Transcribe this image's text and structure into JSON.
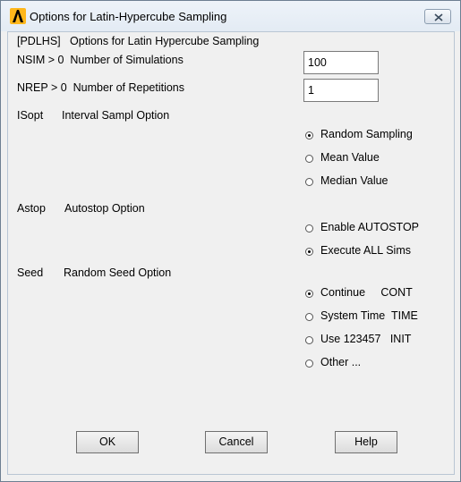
{
  "window": {
    "title": "Options for Latin-Hypercube Sampling",
    "close_label": "×"
  },
  "header": {
    "text": "[PDLHS]   Options for Latin Hypercube Sampling"
  },
  "fields": {
    "nsim": {
      "label": "NSIM > 0  Number of Simulations",
      "value": "100"
    },
    "nrep": {
      "label": "NREP > 0  Number of Repetitions",
      "value": "1"
    }
  },
  "isopt": {
    "key": "ISopt",
    "label": "Interval Sampl Option",
    "options": [
      {
        "label": "Random Sampling",
        "selected": true
      },
      {
        "label": "Mean Value",
        "selected": false
      },
      {
        "label": "Median Value",
        "selected": false
      }
    ]
  },
  "astop": {
    "key": "Astop",
    "label": "Autostop Option",
    "options": [
      {
        "label": "Enable AUTOSTOP",
        "selected": false
      },
      {
        "label": "Execute ALL Sims",
        "selected": true
      }
    ]
  },
  "seed": {
    "key": "Seed",
    "label": "Random Seed Option",
    "options": [
      {
        "label": "Continue     CONT",
        "selected": true
      },
      {
        "label": "System Time  TIME",
        "selected": false
      },
      {
        "label": "Use 123457   INIT",
        "selected": false
      },
      {
        "label": "Other ...",
        "selected": false
      }
    ]
  },
  "buttons": {
    "ok": "OK",
    "cancel": "Cancel",
    "help": "Help"
  },
  "icon": "ansys-logo-icon"
}
